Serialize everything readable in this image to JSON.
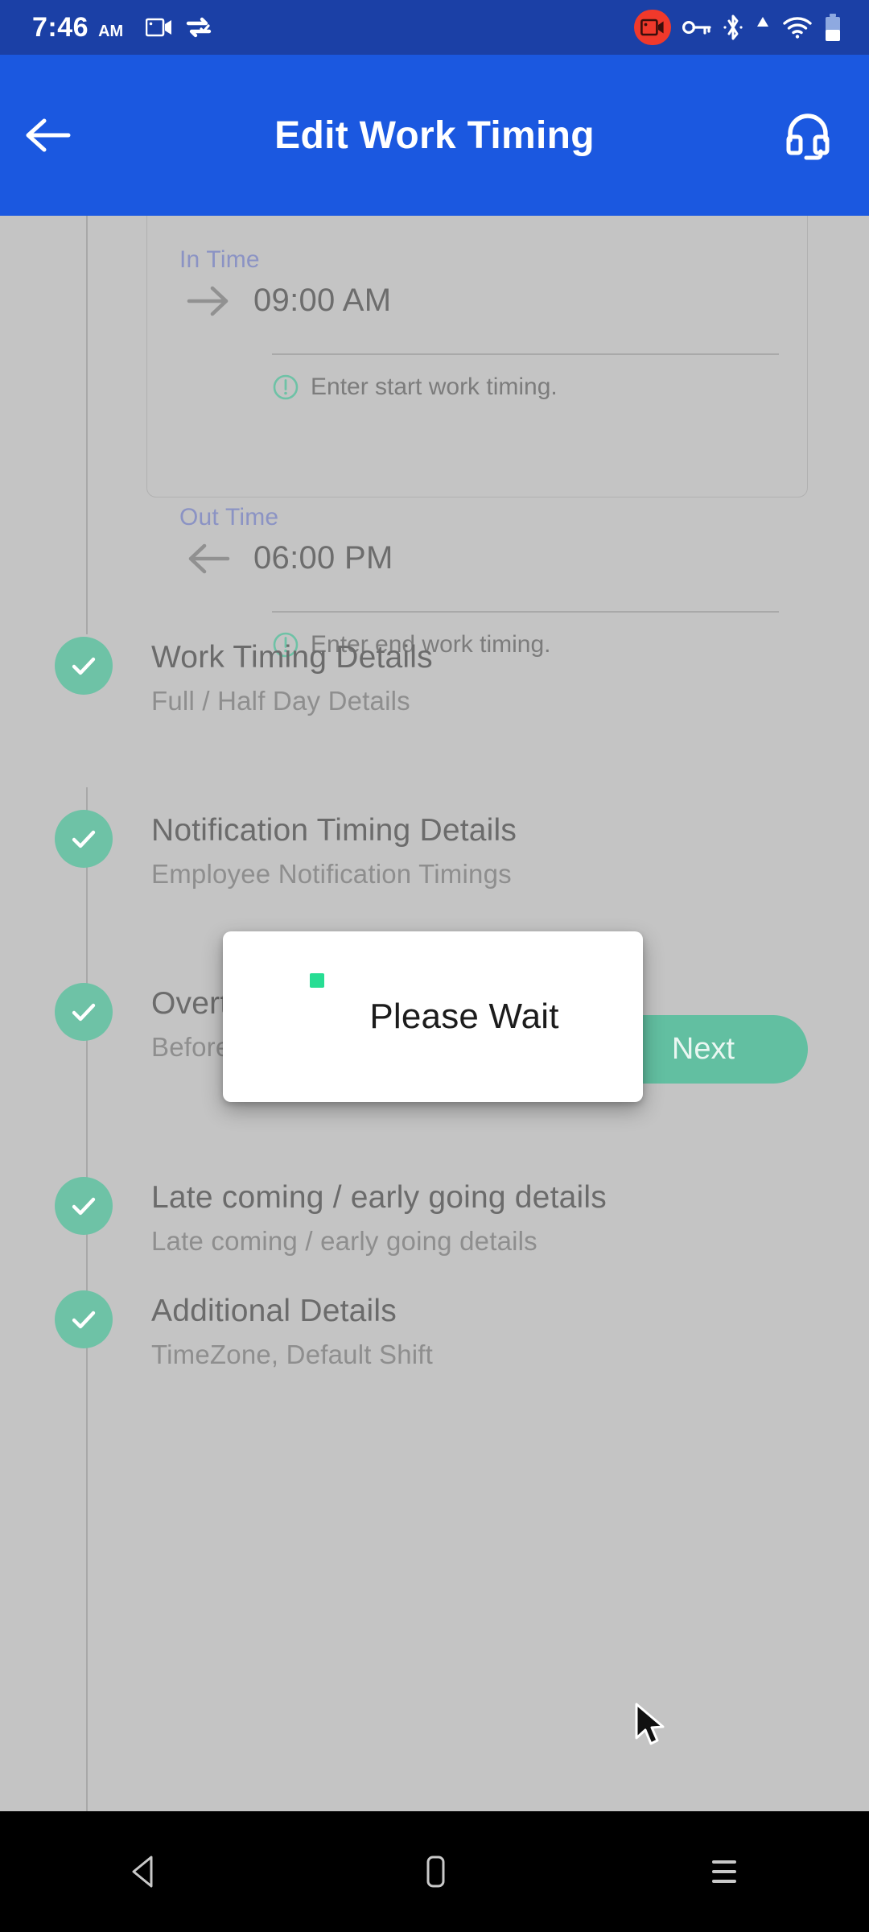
{
  "status_bar": {
    "time": "7:46",
    "meridiem": "AM",
    "left_icons": [
      "video-camera-icon",
      "data-saver-icon"
    ],
    "right_icons": [
      "screen-record-icon",
      "vpn-key-icon",
      "bluetooth-icon",
      "signal-triangle-icon",
      "wifi-icon",
      "battery-icon"
    ],
    "record_badge_color": "#f0392b"
  },
  "app_bar": {
    "title": "Edit Work Timing",
    "back_icon": "arrow-left-icon",
    "support_icon": "headset-icon",
    "background": "#1b58e0"
  },
  "form": {
    "in_time": {
      "label": "In Time",
      "icon": "arrow-right-icon",
      "value": "09:00 AM",
      "helper": "Enter start work timing.",
      "helper_icon": "info-circle-icon"
    },
    "out_time": {
      "label": "Out Time",
      "icon": "arrow-left-icon",
      "value": "06:00 PM",
      "helper": "Enter end work timing.",
      "helper_icon": "info-circle-icon"
    }
  },
  "next_button": {
    "label": "Next",
    "color": "#62bfa1"
  },
  "dialog": {
    "message": "Please Wait",
    "spinner_color": "#27dd93"
  },
  "steps": [
    {
      "title": "Work Timing Details",
      "subtitle": "Full / Half Day Details",
      "state": "completed"
    },
    {
      "title": "Notification Timing Details",
      "subtitle": "Employee Notification Timings",
      "state": "completed"
    },
    {
      "title": "Overtime Details",
      "subtitle": "Before / After Overtime Details",
      "state": "completed"
    },
    {
      "title": "Late coming / early going details",
      "subtitle": "Late coming / early going details",
      "state": "completed"
    },
    {
      "title": "Additional Details",
      "subtitle": "TimeZone, Default Shift",
      "state": "completed"
    }
  ],
  "step_marker_color": "#6ec2a6",
  "nav_bar": {
    "back_icon": "nav-back-triangle-icon",
    "home_icon": "nav-home-icon",
    "recents_icon": "nav-recents-icon"
  }
}
